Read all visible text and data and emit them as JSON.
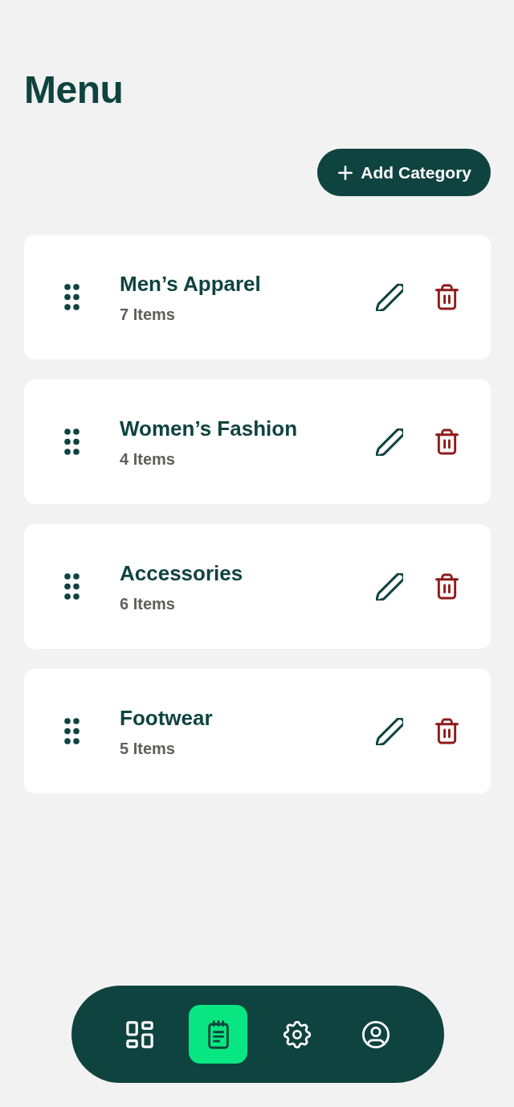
{
  "header": {
    "title": "Menu"
  },
  "add_button": {
    "label": "Add Category"
  },
  "categories": [
    {
      "name": "Men’s Apparel",
      "count": "7 Items"
    },
    {
      "name": "Women’s Fashion",
      "count": "4 Items"
    },
    {
      "name": "Accessories",
      "count": "6 Items"
    },
    {
      "name": "Footwear",
      "count": "5 Items"
    }
  ],
  "nav": [
    {
      "kind": "dashboard",
      "selected": false
    },
    {
      "kind": "notes",
      "selected": true
    },
    {
      "kind": "settings",
      "selected": false
    },
    {
      "kind": "profile",
      "selected": false
    }
  ]
}
